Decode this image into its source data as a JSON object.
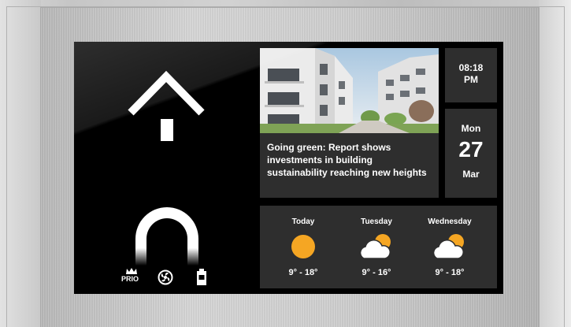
{
  "news": {
    "headline": "Going green: Report shows investments in building sustainability reaching new heights"
  },
  "clock": {
    "time": "08:18\nPM"
  },
  "date": {
    "weekday": "Mon",
    "day": "27",
    "month": "Mar"
  },
  "weather": [
    {
      "day": "Today",
      "icon": "sun-icon",
      "temp": "9° - 18°"
    },
    {
      "day": "Tuesday",
      "icon": "partly-cloudy-icon",
      "temp": "9° - 16°"
    },
    {
      "day": "Wednesday",
      "icon": "partly-cloudy-icon",
      "temp": "9° - 18°"
    }
  ],
  "controls": {
    "prio_label": "PRIO",
    "icons": [
      "up-arrow-icon",
      "door-arch-icon",
      "prio-crown-icon",
      "fan-icon",
      "battery-icon"
    ]
  },
  "colors": {
    "sun": "#f5a623",
    "card": "#2e2e2e",
    "screen": "#000000"
  }
}
